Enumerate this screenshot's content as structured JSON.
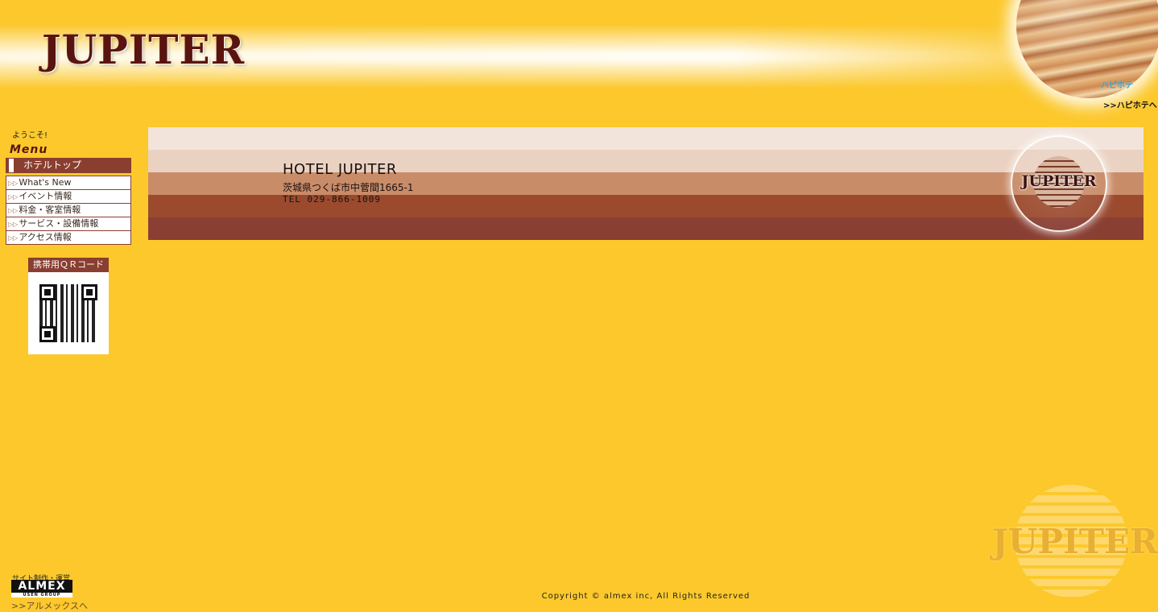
{
  "header": {
    "site_logo": "JUPITER",
    "partner_logo": "ハピホテ",
    "partner_link": ">>ハピホテへ"
  },
  "sidebar": {
    "welcome": "ようこそ!",
    "menu_title": "Menu",
    "top_item": "ホテルトップ",
    "items": [
      {
        "label": "What's New"
      },
      {
        "label": "イベント情報"
      },
      {
        "label": "料金・客室情報"
      },
      {
        "label": "サービス・設備情報"
      },
      {
        "label": "アクセス情報"
      }
    ],
    "qr_title": "携帯用ＱＲコード"
  },
  "hotel": {
    "name": "HOTEL JUPITER",
    "address": "茨城県つくば市中菅間1665-1",
    "tel": "TEL 029-866-1009",
    "emblem_text": "JUPITER"
  },
  "watermark": {
    "text": "JUPITER"
  },
  "footer": {
    "producer_label": "サイト制作・運営",
    "producer_logo": "ALMEX",
    "producer_logo_sub": "USEN GROUP",
    "producer_link": ">>アルメックスへ",
    "copyright": "Copyright © almex inc, All Rights Reserved"
  },
  "colors": {
    "background": "#fcc82c",
    "accent": "#8a3e30",
    "logo": "#5a1410"
  }
}
